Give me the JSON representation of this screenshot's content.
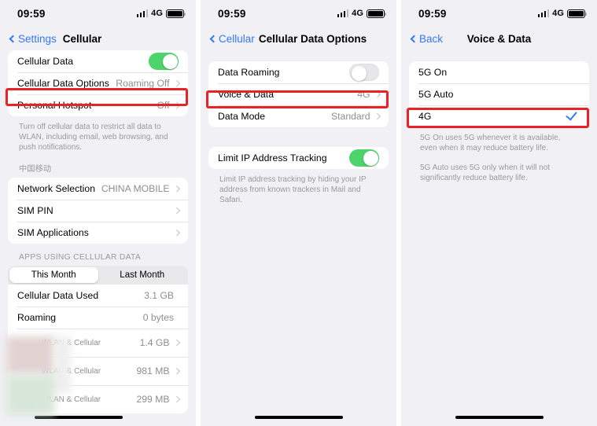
{
  "status": {
    "time": "09:59",
    "network": "4G",
    "signal_bars": 4,
    "signal_active": 3
  },
  "panel1": {
    "back_label": "Settings",
    "title": "Cellular",
    "rows": [
      {
        "label": "Cellular Data",
        "control": "toggle-on"
      },
      {
        "label": "Cellular Data Options",
        "value": "Roaming Off",
        "control": "chevron"
      },
      {
        "label": "Personal Hotspot",
        "value": "Off",
        "control": "chevron"
      }
    ],
    "footnote": "Turn off cellular data to restrict all data to WLAN, including email, web browsing, and push notifications.",
    "carrier_header": "中国移动",
    "carrier_rows": [
      {
        "label": "Network Selection",
        "value": "CHINA MOBILE",
        "control": "chevron"
      },
      {
        "label": "SIM PIN",
        "value": "",
        "control": "chevron"
      },
      {
        "label": "SIM Applications",
        "value": "",
        "control": "chevron"
      }
    ],
    "apps_header": "APPS USING CELLULAR DATA",
    "segments": [
      {
        "label": "This Month",
        "active": true
      },
      {
        "label": "Last Month",
        "active": false
      }
    ],
    "usage_rows": [
      {
        "label": "Cellular Data Used",
        "value": "3.1 GB"
      },
      {
        "label": "Roaming",
        "value": "0 bytes"
      }
    ],
    "app_rows": [
      {
        "name": "",
        "sub": "WLAN & Cellular",
        "value": "1.4 GB"
      },
      {
        "name": "",
        "sub": "WLAN & Cellular",
        "value": "981 MB"
      },
      {
        "name": "",
        "sub": "WLAN & Cellular",
        "value": "299 MB"
      }
    ],
    "highlight_row_index": 1
  },
  "panel2": {
    "back_label": "Cellular",
    "title": "Cellular Data Options",
    "rows": [
      {
        "label": "Data Roaming",
        "control": "toggle-off"
      },
      {
        "label": "Voice & Data",
        "value": "4G",
        "control": "chevron"
      },
      {
        "label": "Data Mode",
        "value": "Standard",
        "control": "chevron"
      }
    ],
    "tracking_row": {
      "label": "Limit IP Address Tracking",
      "control": "toggle-on"
    },
    "tracking_footnote": "Limit IP address tracking by hiding your IP address from known trackers in Mail and Safari.",
    "highlight_row_index": 1
  },
  "panel3": {
    "back_label": "Back",
    "title": "Voice & Data",
    "options": [
      {
        "label": "5G On",
        "selected": false
      },
      {
        "label": "5G Auto",
        "selected": false
      },
      {
        "label": "4G",
        "selected": true
      }
    ],
    "footnote1": "5G On uses 5G whenever it is available, even when it may reduce battery life.",
    "footnote2": "5G Auto uses 5G only when it will not significantly reduce battery life.",
    "highlight_option_index": 2
  },
  "colors": {
    "accent_blue": "#3478f6",
    "toggle_green": "#4cd369",
    "highlight_red": "#ea2226",
    "page_bg": "#f1f1f5"
  }
}
